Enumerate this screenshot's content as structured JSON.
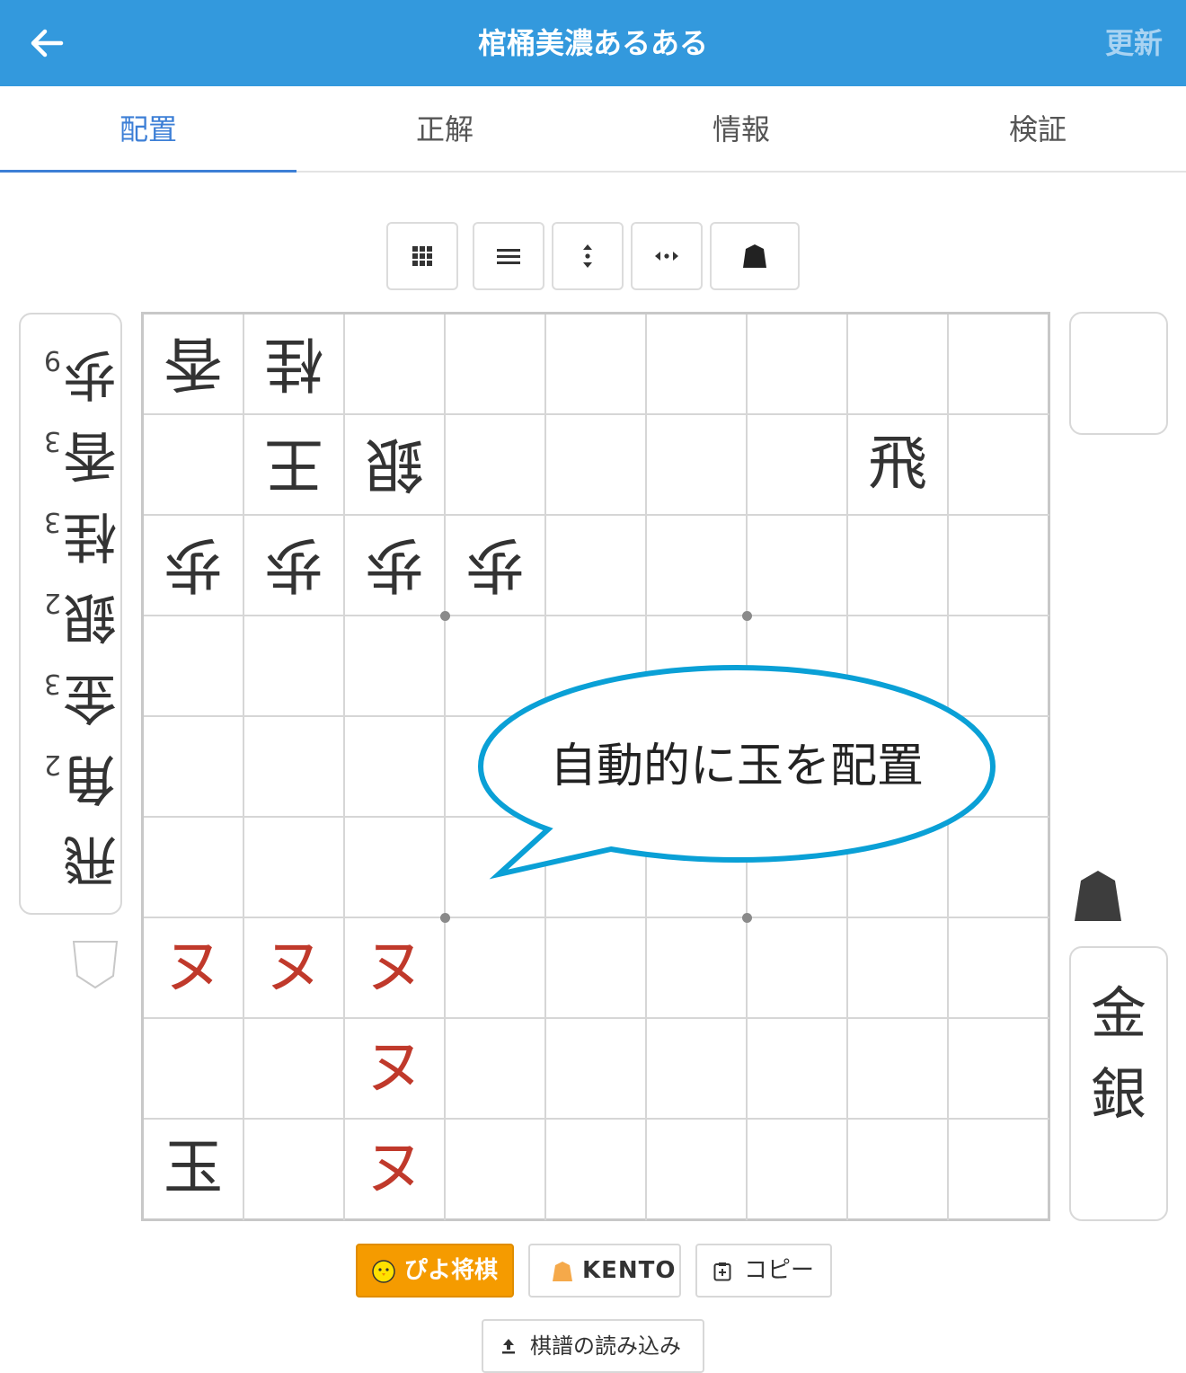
{
  "header": {
    "title": "棺桶美濃あるある",
    "update_label": "更新"
  },
  "tabs": [
    {
      "label": "配置",
      "active": true
    },
    {
      "label": "正解",
      "active": false
    },
    {
      "label": "情報",
      "active": false
    },
    {
      "label": "検証",
      "active": false
    }
  ],
  "toolbar": [
    "grid-icon",
    "menu-icon",
    "flip-vertical-icon",
    "flip-horizontal-icon",
    "shogi-piece-icon"
  ],
  "gote_hand": [
    {
      "piece": "歩",
      "count": "9"
    },
    {
      "piece": "香",
      "count": "3"
    },
    {
      "piece": "桂",
      "count": "3"
    },
    {
      "piece": "銀",
      "count": "2"
    },
    {
      "piece": "金",
      "count": "3"
    },
    {
      "piece": "角",
      "count": "2"
    },
    {
      "piece": "飛",
      "count": ""
    }
  ],
  "board": {
    "pieces": [
      {
        "row": 0,
        "col": 0,
        "text": "香",
        "side": "gote"
      },
      {
        "row": 0,
        "col": 1,
        "text": "桂",
        "side": "gote"
      },
      {
        "row": 1,
        "col": 1,
        "text": "王",
        "side": "gote"
      },
      {
        "row": 1,
        "col": 2,
        "text": "銀",
        "side": "gote"
      },
      {
        "row": 1,
        "col": 7,
        "text": "飛",
        "side": "sente"
      },
      {
        "row": 2,
        "col": 0,
        "text": "歩",
        "side": "gote"
      },
      {
        "row": 2,
        "col": 1,
        "text": "歩",
        "side": "gote"
      },
      {
        "row": 2,
        "col": 2,
        "text": "歩",
        "side": "gote"
      },
      {
        "row": 2,
        "col": 3,
        "text": "歩",
        "side": "gote"
      },
      {
        "row": 6,
        "col": 0,
        "text": "ヌ",
        "side": "red"
      },
      {
        "row": 6,
        "col": 1,
        "text": "ヌ",
        "side": "red"
      },
      {
        "row": 6,
        "col": 2,
        "text": "ヌ",
        "side": "red"
      },
      {
        "row": 7,
        "col": 2,
        "text": "ヌ",
        "side": "red"
      },
      {
        "row": 8,
        "col": 0,
        "text": "玉",
        "side": "sente"
      },
      {
        "row": 8,
        "col": 2,
        "text": "ヌ",
        "side": "red"
      }
    ]
  },
  "callout": "自動的に玉を配置",
  "sente_hand": [
    "金",
    "銀"
  ],
  "buttons": {
    "piyo": "ぴよ将棋",
    "kento": "KENTO",
    "copy": "コピー",
    "load": "棋譜の読み込み"
  },
  "colors": {
    "header": "#3399dd",
    "active_tab": "#3d7fd6",
    "callout_border": "#0aa0d6",
    "red_piece": "#c0392b",
    "piyo": "#f59b00"
  }
}
